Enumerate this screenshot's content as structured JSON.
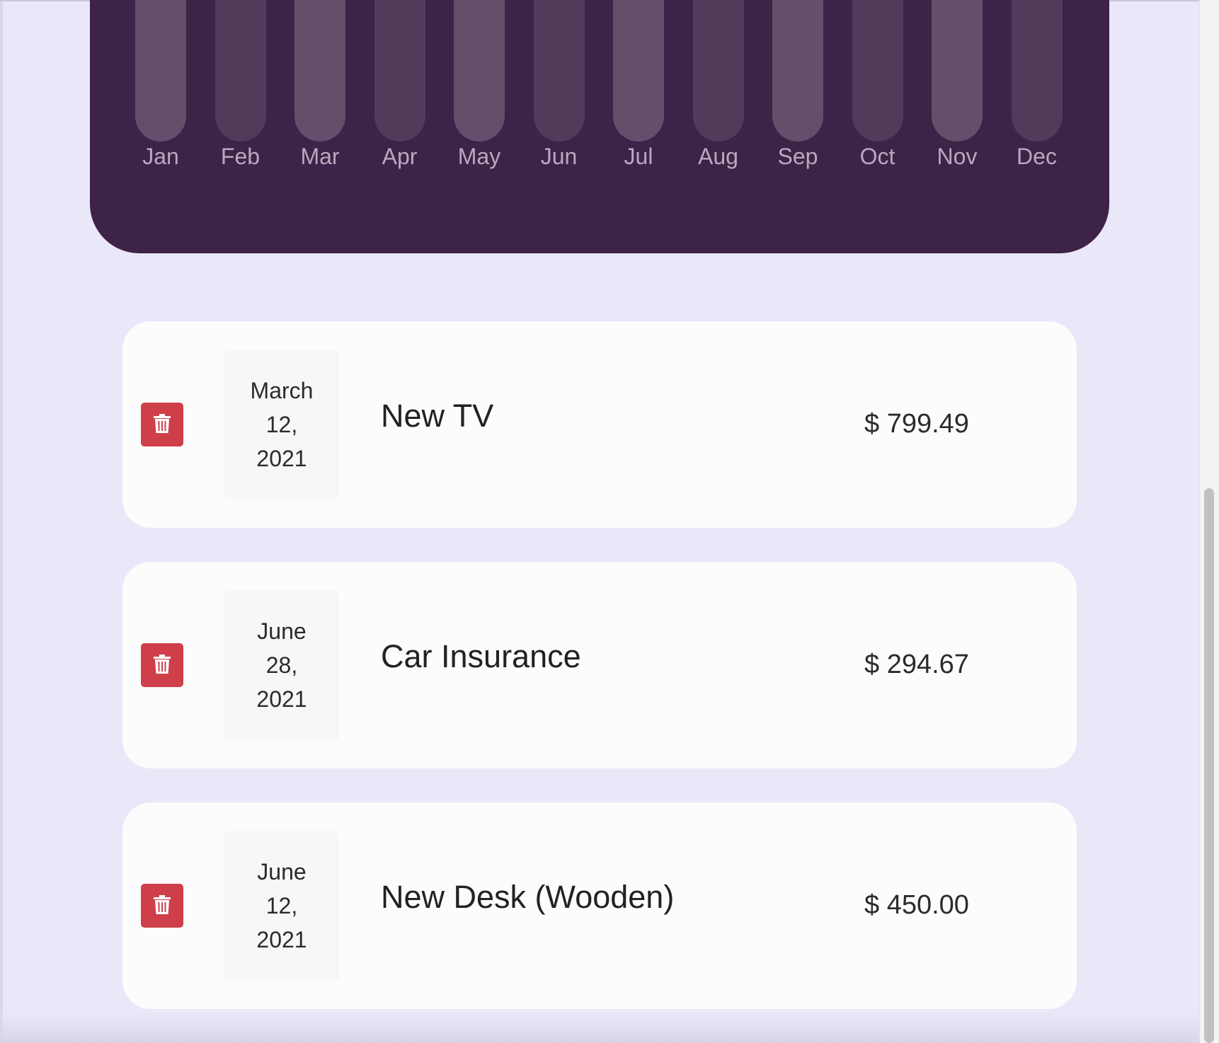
{
  "colors": {
    "page_bg": "#e9e7f8",
    "chart_bg": "#3d2347",
    "bar_light": "#634f6b",
    "bar_dark": "#533a5b",
    "month_label": "#b7a9bf",
    "card_bg": "#fcfcfd",
    "date_bg": "#f8f6f9",
    "delete_red": "#cf3f4a"
  },
  "chart": {
    "months": [
      "Jan",
      "Feb",
      "Mar",
      "Apr",
      "May",
      "Jun",
      "Jul",
      "Aug",
      "Sep",
      "Oct",
      "Nov",
      "Dec"
    ],
    "bar_shades": [
      "light",
      "dark",
      "light",
      "dark",
      "light",
      "dark",
      "light",
      "dark",
      "light",
      "dark",
      "light",
      "dark"
    ]
  },
  "expenses": [
    {
      "date_month": "March",
      "date_day": "12,",
      "date_year": "2021",
      "title": "New TV",
      "amount": "$ 799.49",
      "delete_icon": "trash-icon"
    },
    {
      "date_month": "June",
      "date_day": "28,",
      "date_year": "2021",
      "title": "Car Insurance",
      "amount": "$ 294.67",
      "delete_icon": "trash-icon"
    },
    {
      "date_month": "June",
      "date_day": "12,",
      "date_year": "2021",
      "title": "New Desk (Wooden)",
      "amount": "$ 450.00",
      "delete_icon": "trash-icon"
    }
  ]
}
